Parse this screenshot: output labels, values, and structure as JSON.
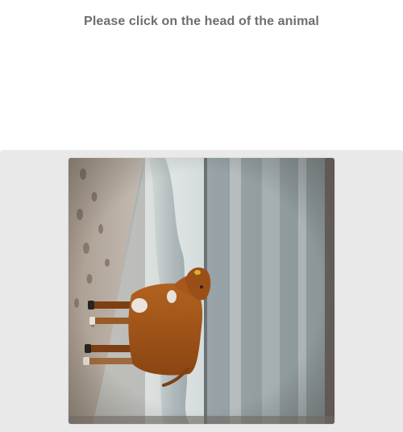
{
  "captcha": {
    "instruction": "Please click on the head of the animal",
    "image_subject": "cow-on-beach",
    "colors": {
      "instruction_text": "#6e6e6e",
      "stage_background": "#e9e9e9"
    }
  }
}
